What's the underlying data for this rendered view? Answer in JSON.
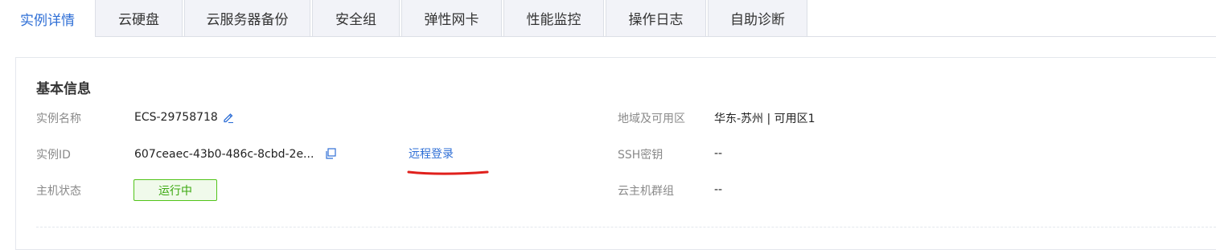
{
  "tabs": [
    {
      "label": "实例详情",
      "active": true
    },
    {
      "label": "云硬盘"
    },
    {
      "label": "云服务器备份"
    },
    {
      "label": "安全组"
    },
    {
      "label": "弹性网卡"
    },
    {
      "label": "性能监控"
    },
    {
      "label": "操作日志"
    },
    {
      "label": "自助诊断"
    }
  ],
  "section": {
    "title": "基本信息"
  },
  "fields": {
    "instance_name": {
      "label": "实例名称",
      "value": "ECS-29758718"
    },
    "instance_id": {
      "label": "实例ID",
      "value": "607ceaec-43b0-486c-8cbd-2e..."
    },
    "host_status": {
      "label": "主机状态",
      "value": "运行中"
    },
    "region_zone": {
      "label": "地域及可用区",
      "value": "华东-苏州 | 可用区1"
    },
    "ssh_key": {
      "label": "SSH密钥",
      "value": "--"
    },
    "host_group": {
      "label": "云主机群组",
      "value": "--"
    }
  },
  "actions": {
    "remote_login": "远程登录"
  },
  "icons": {
    "edit": "pencil-edit-icon",
    "copy": "copy-icon"
  },
  "colors": {
    "accent": "#2f6fd6",
    "status_green": "#52c41a",
    "annotation_red": "#e0201c"
  }
}
